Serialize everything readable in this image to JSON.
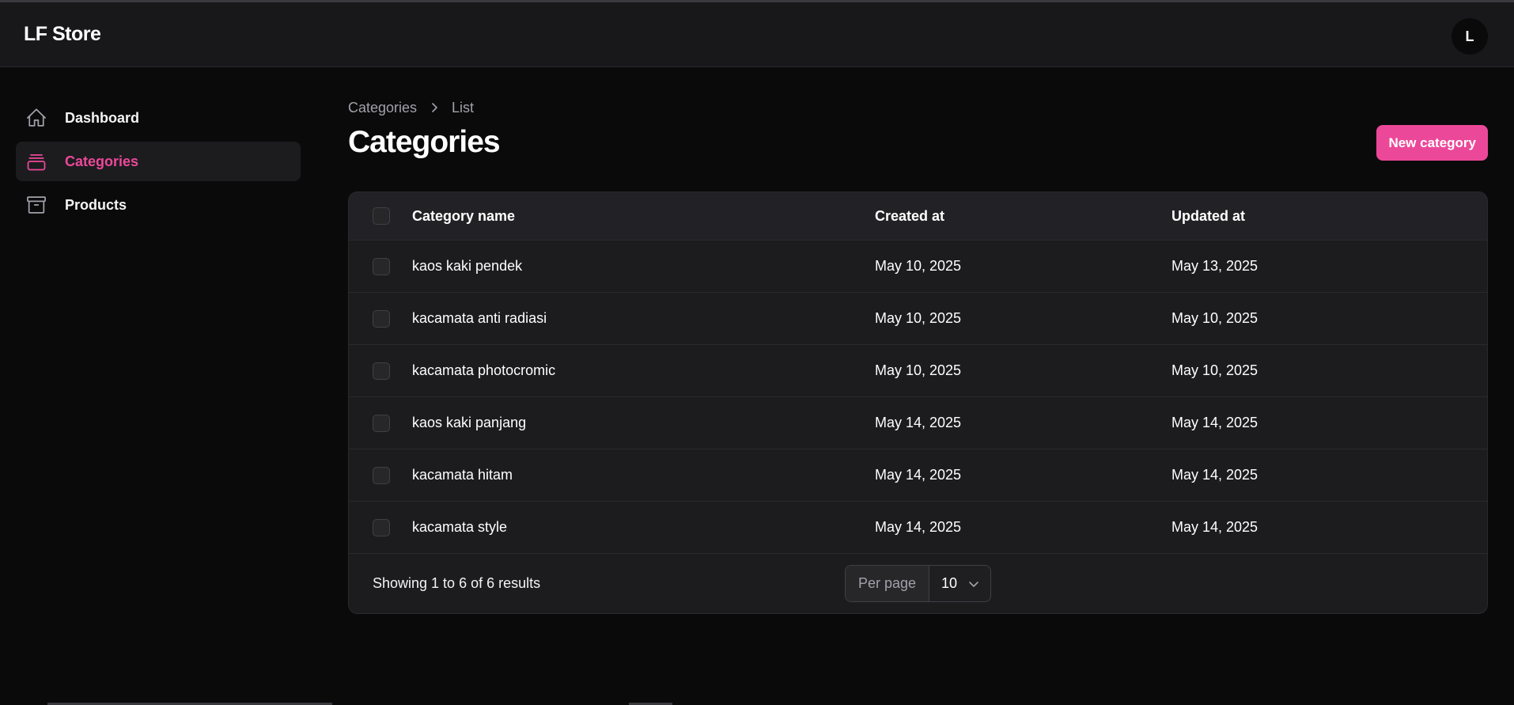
{
  "app": {
    "brand": "LF Store",
    "avatar_initial": "L"
  },
  "sidebar": {
    "items": [
      {
        "label": "Dashboard",
        "icon": "home-icon",
        "active": false
      },
      {
        "label": "Categories",
        "icon": "stack-icon",
        "active": true
      },
      {
        "label": "Products",
        "icon": "archive-box-icon",
        "active": false
      }
    ]
  },
  "breadcrumb": {
    "parent": "Categories",
    "current": "List"
  },
  "page": {
    "title": "Categories",
    "new_button": "New category"
  },
  "table": {
    "headers": {
      "name": "Category name",
      "created": "Created at",
      "updated": "Updated at"
    },
    "rows": [
      {
        "name": "kaos kaki pendek",
        "created": "May 10, 2025",
        "updated": "May 13, 2025"
      },
      {
        "name": "kacamata anti radiasi",
        "created": "May 10, 2025",
        "updated": "May 10, 2025"
      },
      {
        "name": "kacamata photocromic",
        "created": "May 10, 2025",
        "updated": "May 10, 2025"
      },
      {
        "name": "kaos kaki panjang",
        "created": "May 14, 2025",
        "updated": "May 14, 2025"
      },
      {
        "name": "kacamata hitam",
        "created": "May 14, 2025",
        "updated": "May 14, 2025"
      },
      {
        "name": "kacamata style",
        "created": "May 14, 2025",
        "updated": "May 14, 2025"
      }
    ]
  },
  "pagination": {
    "results": "Showing 1 to 6 of 6 results",
    "per_page_label": "Per page",
    "per_page_value": "10"
  },
  "colors": {
    "accent": "#ec4899",
    "background": "#0a0a0b",
    "panel": "#1c1c1f"
  }
}
